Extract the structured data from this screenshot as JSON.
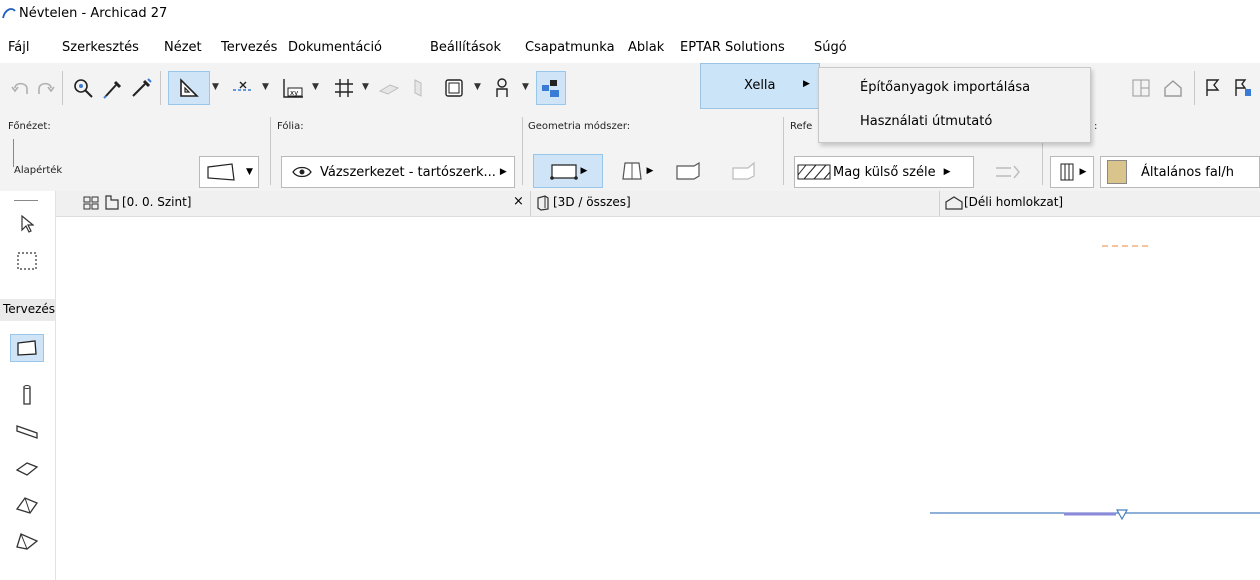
{
  "window": {
    "title": "Névtelen - Archicad 27"
  },
  "menubar": [
    "Fájl",
    "Szerkesztés",
    "Nézet",
    "Tervezés",
    "Dokumentáció",
    "Beállítások",
    "Csapatmunka",
    "Ablak",
    "EPTAR Solutions",
    "Súgó"
  ],
  "menu_open": {
    "parent": "EPTAR Solutions",
    "submenu_label": "Xella",
    "items": [
      "Építőanyagok importálása",
      "Használati útmutató"
    ]
  },
  "infobox": {
    "sections": {
      "main_view": "Főnézet:",
      "layer": "Fólia:",
      "geometry": "Geometria módszer:",
      "reference": "Refe",
      "last": ":"
    },
    "main_view_value": "Alapérték",
    "layer_value": "Vázszerkezet - tartószerk...",
    "reference_value": "Mag külső széle",
    "composite_value": "Általános fal/h"
  },
  "toolbox": {
    "section_label": "Tervezés"
  },
  "tabs": [
    {
      "label": "[0. 0. Szint]",
      "close": "×"
    },
    {
      "label": "[3D / összes]"
    },
    {
      "label": "[Déli homlokzat]"
    }
  ],
  "colors": {
    "menu_highlight": "#cce4f7",
    "selected_tool": "#cfe4f7",
    "accent": "#3a7bd5"
  }
}
